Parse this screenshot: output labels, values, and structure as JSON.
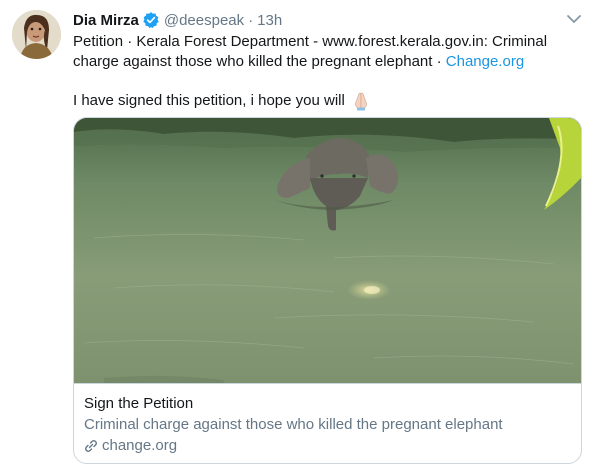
{
  "tweet": {
    "author_name": "Dia Mirza",
    "handle": "@deespeak",
    "separator": "·",
    "time": "13h",
    "text_main": "Petition · Kerala Forest Department - www.forest.kerala.gov.in: Criminal charge against those who killed the pregnant elephant · ",
    "text_link": "Change.org",
    "text_second": "I have signed this petition, i hope you will",
    "emoji": "pray-icon"
  },
  "card": {
    "title": "Sign the Petition",
    "description": "Criminal charge against those who killed the pregnant elephant",
    "domain": "change.org",
    "image": "elephant-in-river-photo"
  },
  "colors": {
    "link": "#1b95e0",
    "verified": "#1da1f2",
    "secondary_text": "#657786",
    "border": "#ccd6dd"
  }
}
